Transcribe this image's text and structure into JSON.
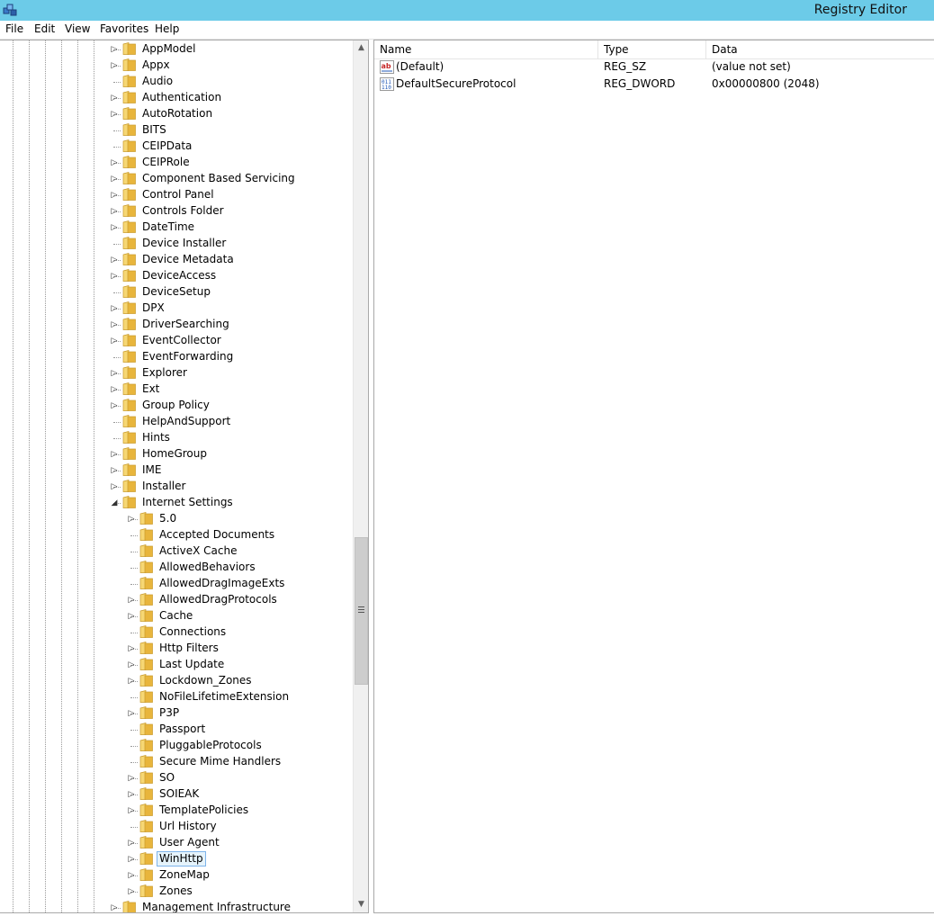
{
  "window": {
    "title": "Registry Editor"
  },
  "menu": [
    "File",
    "Edit",
    "View",
    "Favorites",
    "Help"
  ],
  "tree": {
    "items": [
      {
        "label": "AppModel",
        "level": 0,
        "expander": "collapsed"
      },
      {
        "label": "Appx",
        "level": 0,
        "expander": "collapsed"
      },
      {
        "label": "Audio",
        "level": 0,
        "expander": "none"
      },
      {
        "label": "Authentication",
        "level": 0,
        "expander": "collapsed"
      },
      {
        "label": "AutoRotation",
        "level": 0,
        "expander": "collapsed"
      },
      {
        "label": "BITS",
        "level": 0,
        "expander": "none"
      },
      {
        "label": "CEIPData",
        "level": 0,
        "expander": "none"
      },
      {
        "label": "CEIPRole",
        "level": 0,
        "expander": "collapsed"
      },
      {
        "label": "Component Based Servicing",
        "level": 0,
        "expander": "collapsed"
      },
      {
        "label": "Control Panel",
        "level": 0,
        "expander": "collapsed"
      },
      {
        "label": "Controls Folder",
        "level": 0,
        "expander": "collapsed"
      },
      {
        "label": "DateTime",
        "level": 0,
        "expander": "collapsed"
      },
      {
        "label": "Device Installer",
        "level": 0,
        "expander": "none"
      },
      {
        "label": "Device Metadata",
        "level": 0,
        "expander": "collapsed"
      },
      {
        "label": "DeviceAccess",
        "level": 0,
        "expander": "collapsed"
      },
      {
        "label": "DeviceSetup",
        "level": 0,
        "expander": "none"
      },
      {
        "label": "DPX",
        "level": 0,
        "expander": "collapsed"
      },
      {
        "label": "DriverSearching",
        "level": 0,
        "expander": "collapsed"
      },
      {
        "label": "EventCollector",
        "level": 0,
        "expander": "collapsed"
      },
      {
        "label": "EventForwarding",
        "level": 0,
        "expander": "none"
      },
      {
        "label": "Explorer",
        "level": 0,
        "expander": "collapsed"
      },
      {
        "label": "Ext",
        "level": 0,
        "expander": "collapsed"
      },
      {
        "label": "Group Policy",
        "level": 0,
        "expander": "collapsed"
      },
      {
        "label": "HelpAndSupport",
        "level": 0,
        "expander": "none"
      },
      {
        "label": "Hints",
        "level": 0,
        "expander": "none"
      },
      {
        "label": "HomeGroup",
        "level": 0,
        "expander": "collapsed"
      },
      {
        "label": "IME",
        "level": 0,
        "expander": "collapsed"
      },
      {
        "label": "Installer",
        "level": 0,
        "expander": "collapsed"
      },
      {
        "label": "Internet Settings",
        "level": 0,
        "expander": "expanded"
      },
      {
        "label": "5.0",
        "level": 1,
        "expander": "collapsed"
      },
      {
        "label": "Accepted Documents",
        "level": 1,
        "expander": "none"
      },
      {
        "label": "ActiveX Cache",
        "level": 1,
        "expander": "none"
      },
      {
        "label": "AllowedBehaviors",
        "level": 1,
        "expander": "none"
      },
      {
        "label": "AllowedDragImageExts",
        "level": 1,
        "expander": "none"
      },
      {
        "label": "AllowedDragProtocols",
        "level": 1,
        "expander": "collapsed"
      },
      {
        "label": "Cache",
        "level": 1,
        "expander": "collapsed"
      },
      {
        "label": "Connections",
        "level": 1,
        "expander": "none"
      },
      {
        "label": "Http Filters",
        "level": 1,
        "expander": "collapsed"
      },
      {
        "label": "Last Update",
        "level": 1,
        "expander": "collapsed"
      },
      {
        "label": "Lockdown_Zones",
        "level": 1,
        "expander": "collapsed"
      },
      {
        "label": "NoFileLifetimeExtension",
        "level": 1,
        "expander": "none"
      },
      {
        "label": "P3P",
        "level": 1,
        "expander": "collapsed"
      },
      {
        "label": "Passport",
        "level": 1,
        "expander": "none"
      },
      {
        "label": "PluggableProtocols",
        "level": 1,
        "expander": "none"
      },
      {
        "label": "Secure Mime Handlers",
        "level": 1,
        "expander": "none"
      },
      {
        "label": "SO",
        "level": 1,
        "expander": "collapsed"
      },
      {
        "label": "SOIEAK",
        "level": 1,
        "expander": "collapsed"
      },
      {
        "label": "TemplatePolicies",
        "level": 1,
        "expander": "collapsed"
      },
      {
        "label": "Url History",
        "level": 1,
        "expander": "none"
      },
      {
        "label": "User Agent",
        "level": 1,
        "expander": "collapsed"
      },
      {
        "label": "WinHttp",
        "level": 1,
        "expander": "collapsed",
        "selected": true
      },
      {
        "label": "ZoneMap",
        "level": 1,
        "expander": "collapsed"
      },
      {
        "label": "Zones",
        "level": 1,
        "expander": "collapsed"
      },
      {
        "label": "Management Infrastructure",
        "level": 0,
        "expander": "collapsed"
      }
    ]
  },
  "list": {
    "columns": [
      "Name",
      "Type",
      "Data"
    ],
    "rows": [
      {
        "icon": "string-value-icon",
        "name": "(Default)",
        "type": "REG_SZ",
        "data": "(value not set)"
      },
      {
        "icon": "binary-value-icon",
        "name": "DefaultSecureProtocol",
        "type": "REG_DWORD",
        "data": "0x00000800 (2048)"
      }
    ]
  },
  "colors": {
    "titlebar": "#6ccbe8",
    "selection": "#e5f3fb",
    "selection_border": "#7eb4ea",
    "folder": "#e8b53c"
  }
}
